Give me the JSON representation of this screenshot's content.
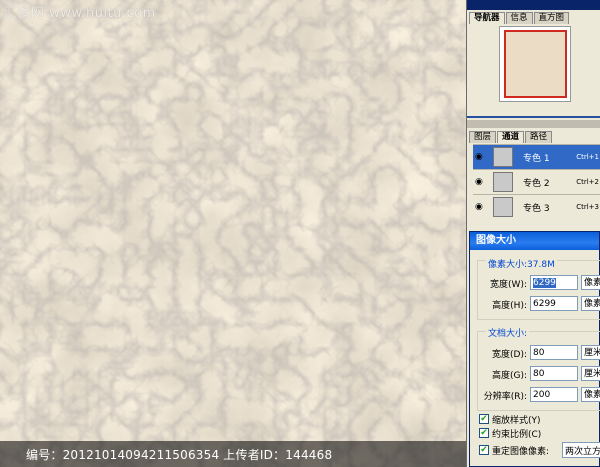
{
  "watermark": "汇图网 www.huitu.com",
  "caption": "编号：20121014094211506354 上传者ID：144468",
  "top_panel": {
    "tabs": [
      "导航器",
      "信息",
      "直方图"
    ]
  },
  "mid_panel": {
    "tabs": [
      "图层",
      "通道",
      "路径"
    ],
    "channels": [
      {
        "name": "专色 1",
        "shortcut": "Ctrl+1",
        "selected": true
      },
      {
        "name": "专色 2",
        "shortcut": "Ctrl+2",
        "selected": false
      },
      {
        "name": "专色 3",
        "shortcut": "Ctrl+3",
        "selected": false
      }
    ]
  },
  "dialog": {
    "title": "图像大小",
    "pixel_group": "像素大小:37.8M",
    "width_label": "宽度(W):",
    "width_value": "6299",
    "width_unit": "像素",
    "height_label": "高度(H):",
    "height_value": "6299",
    "height_unit": "像素",
    "doc_group": "文档大小:",
    "doc_width_label": "宽度(D):",
    "doc_width_value": "80",
    "doc_width_unit": "厘米",
    "doc_height_label": "高度(G):",
    "doc_height_value": "80",
    "doc_height_unit": "厘米",
    "res_label": "分辨率(R):",
    "res_value": "200",
    "res_unit": "像素",
    "scale_styles": "缩放样式(Y)",
    "constrain": "约束比例(C)",
    "resample": "重定图像像素:",
    "resample_value": "两次立方"
  },
  "colors": {
    "marble_base": "#e8dcc8",
    "selection_blue": "#3169c6",
    "title_blue": "#0a5fd9"
  }
}
